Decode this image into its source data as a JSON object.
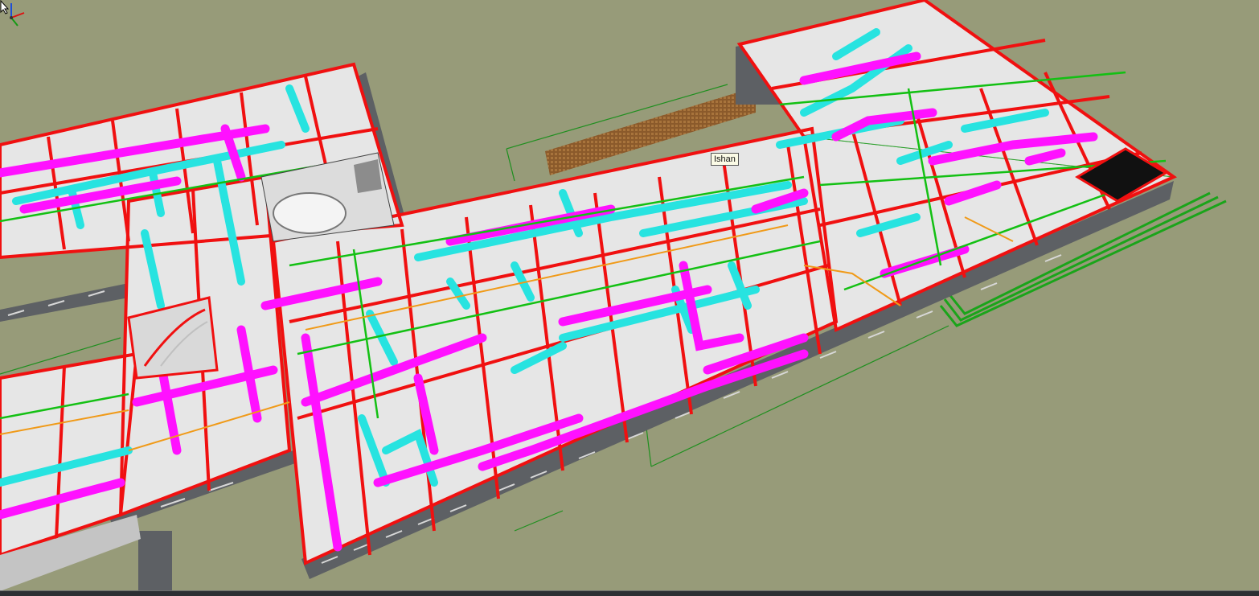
{
  "viewport": {
    "background": "#979b79",
    "palette": {
      "ducts_cyan": "#27e3e0",
      "ducts_magenta": "#ff11ff",
      "walls_red": "#f01010",
      "pipes_green": "#13c013",
      "pipes_orange": "#f09a18",
      "floor": "#e9e9e9",
      "exterior_wall": "#5f6164",
      "brick_screen": "#8b5a2b"
    }
  },
  "tooltip": {
    "text": "Ishan"
  },
  "axis_triad": {
    "icon": "axis-triad-icon"
  },
  "cursor": {
    "icon": "mouse-pointer-icon"
  }
}
